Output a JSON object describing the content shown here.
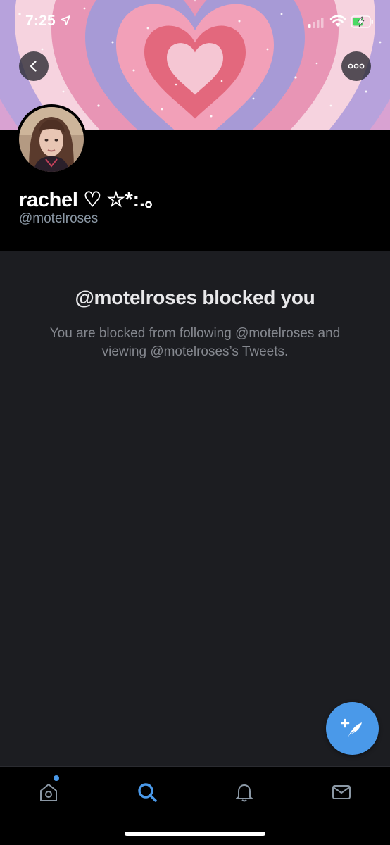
{
  "status_bar": {
    "time": "7:25"
  },
  "profile": {
    "display_name": "rachel ♡ ☆*:.｡",
    "handle": "@motelroses"
  },
  "blocked": {
    "title": "@motelroses blocked you",
    "description": "You are blocked from following @motelroses and viewing @motelroses’s Tweets."
  },
  "colors": {
    "accent": "#4a99e9",
    "background": "#1c1d21",
    "header_background": "#000000",
    "muted_text": "#8b98a5"
  },
  "icons": {
    "back": "chevron-left-icon",
    "more": "more-dots-icon",
    "compose": "compose-tweet-icon",
    "home": "home-icon",
    "search": "search-icon",
    "notifications": "bell-icon",
    "messages": "mail-icon"
  },
  "tab_bar": {
    "active": "search",
    "home_has_new": true
  }
}
